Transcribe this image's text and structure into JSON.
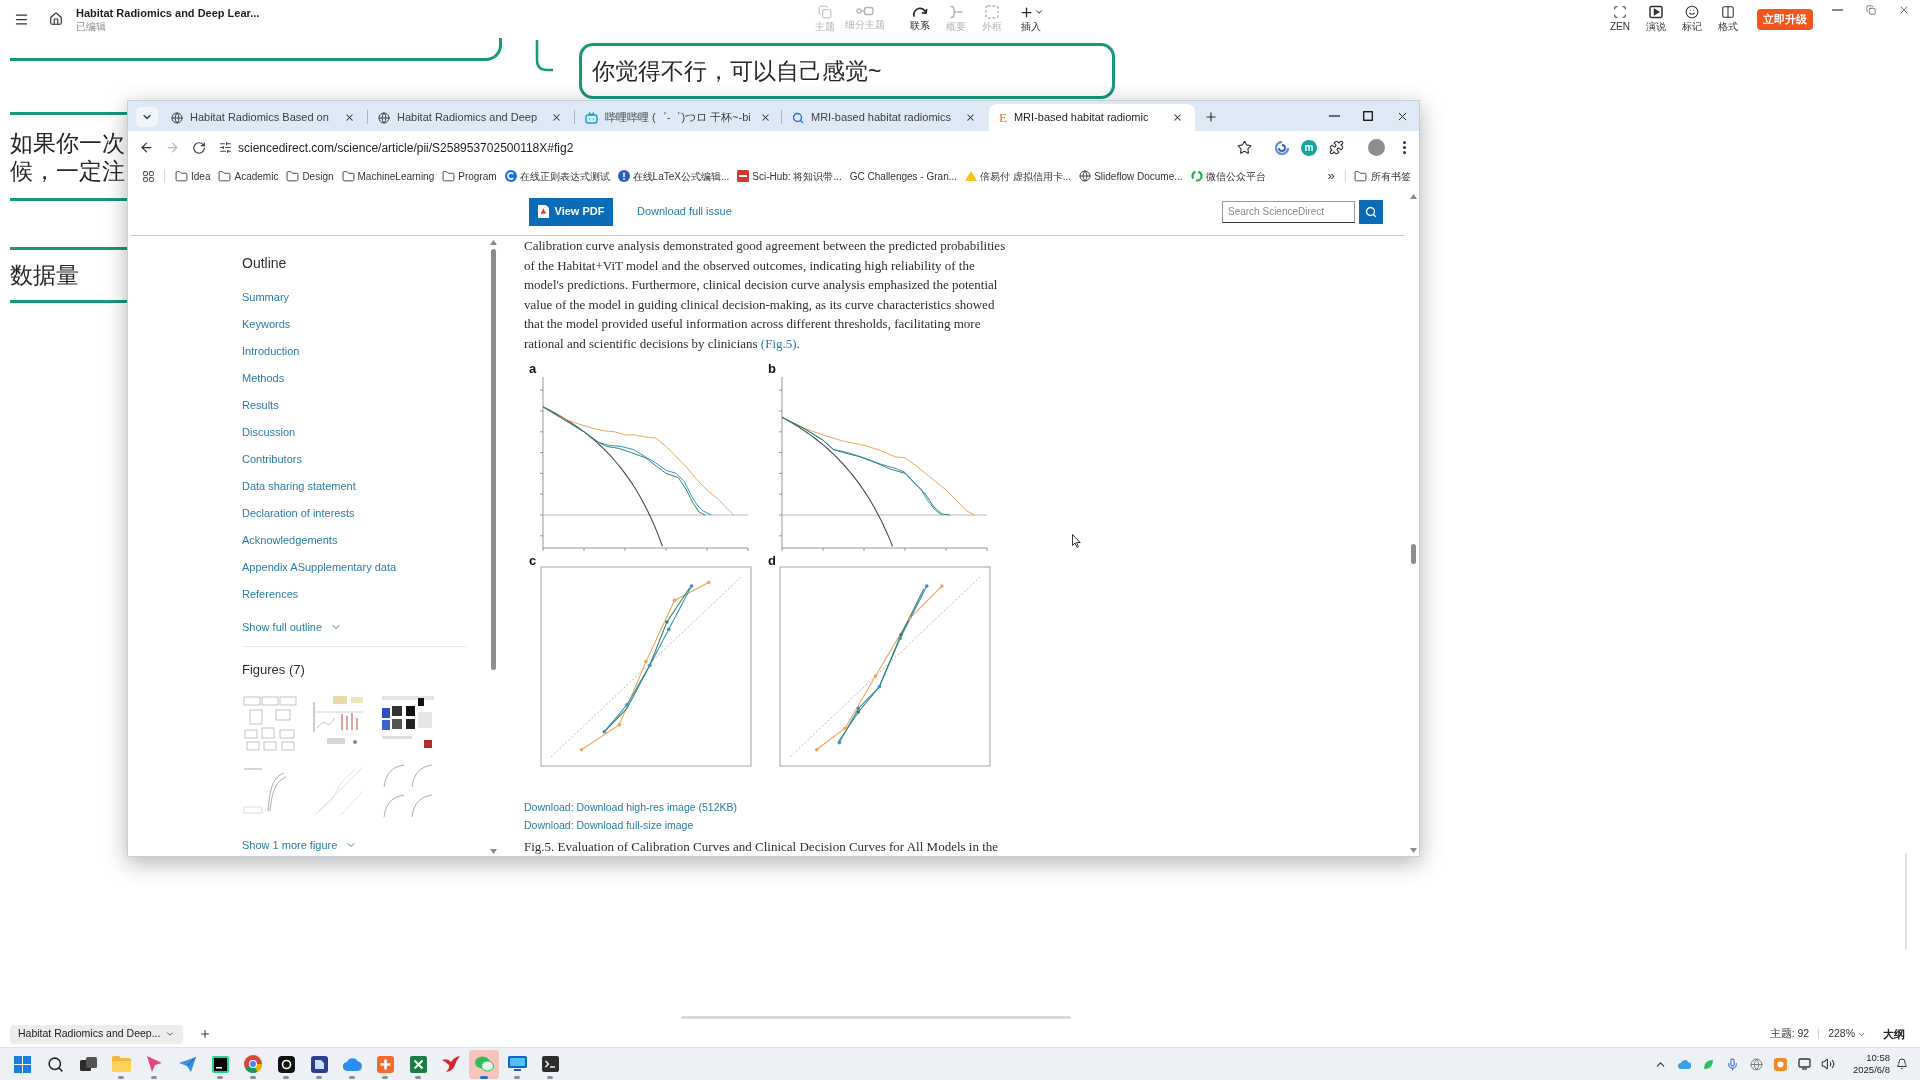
{
  "app": {
    "title": "Habitat Radiomics and Deep Lear...",
    "status": "已编辑",
    "toolbar": [
      {
        "label": "主题",
        "kind": "topic",
        "disabled": true
      },
      {
        "label": "细分主题",
        "kind": "subtopic",
        "disabled": true
      },
      {
        "label": "联系",
        "kind": "relation",
        "disabled": false
      },
      {
        "label": "概要",
        "kind": "summary",
        "disabled": true
      },
      {
        "label": "外框",
        "kind": "boundary",
        "disabled": true
      },
      {
        "label": "插入",
        "kind": "insert",
        "disabled": false
      }
    ],
    "view_tools": [
      {
        "label": "ZEN",
        "kind": "zen"
      },
      {
        "label": "演说",
        "kind": "pitch"
      },
      {
        "label": "标记",
        "kind": "marker"
      },
      {
        "label": "格式",
        "kind": "format"
      }
    ],
    "upgrade": "立即升级"
  },
  "mind_map": {
    "nodes": [
      {
        "kind": "clipped"
      },
      {
        "kind": "connector"
      },
      {
        "kind": "callout",
        "lines": [
          "你觉得不行，可以自己感觉~"
        ]
      },
      {
        "kind": "band",
        "lines": [
          "如果你一次",
          "候，一定注"
        ]
      },
      {
        "kind": "band",
        "lines": [
          "数据量"
        ]
      }
    ]
  },
  "browser": {
    "tabs": [
      {
        "title": "Habitat Radiomics Based on",
        "kind": "globe",
        "selected": false
      },
      {
        "title": "Habitat Radiomics and Deep",
        "kind": "globe",
        "selected": false
      },
      {
        "title": "哔哩哔哩 (゜-゜)つロ 干杯~-bi",
        "kind": "tv",
        "selected": false
      },
      {
        "title": "MRI-based habitat radiomics",
        "kind": "search",
        "selected": false
      },
      {
        "title": "MRI-based habitat radiomic",
        "kind": "letter",
        "glyph": "E",
        "selected": true
      }
    ],
    "nav": {
      "back_disabled": false,
      "forward_disabled": true
    },
    "address": "sciencedirect.com/science/article/pii/S258953702500118X#fig2",
    "extension": "m",
    "bookmarks": [
      {
        "label": "Idea",
        "kind": "folder"
      },
      {
        "label": "Academic",
        "kind": "folder"
      },
      {
        "label": "Design",
        "kind": "folder"
      },
      {
        "label": "MachineLearning",
        "kind": "folder"
      },
      {
        "label": "Program",
        "kind": "folder"
      },
      {
        "label": "在线正则表达式测试",
        "kind": "ring"
      },
      {
        "label": "在线LaTeX公式编辑...",
        "kind": "dot"
      },
      {
        "label": "Sci-Hub: 将知识带...",
        "kind": "tile"
      },
      {
        "label": "GC Challenges - Gran...",
        "kind": "none"
      },
      {
        "label": "倍易付 虚拟信用卡...",
        "kind": "wedge"
      },
      {
        "label": "Slideflow Docume...",
        "kind": "globe"
      },
      {
        "label": "微信公众平台",
        "kind": "swirl"
      }
    ],
    "overflow": "»",
    "all_bookmarks": "所有书签"
  },
  "page": {
    "view_pdf": "View PDF",
    "download_issue": "Download full issue",
    "search_placeholder": "Search ScienceDirect",
    "outline": {
      "title": "Outline",
      "items": [
        "Summary",
        "Keywords",
        "Introduction",
        "Methods",
        "Results",
        "Discussion",
        "Contributors",
        "Data sharing statement",
        "Declaration of interests",
        "Acknowledgements",
        "Appendix ASupplementary data",
        "References"
      ],
      "more": "Show full outline"
    },
    "figures": {
      "title": "Figures (7)",
      "thumbnails": [
        {
          "kind": "flowchart"
        },
        {
          "kind": "plots"
        },
        {
          "kind": "scans"
        },
        {
          "kind": "roc"
        },
        {
          "kind": "calibration"
        },
        {
          "kind": "roc_grid"
        }
      ],
      "more": "Show 1 more figure"
    },
    "article": {
      "text": "Calibration curve analysis demonstrated good agreement between the predicted probabilities of the Habitat+ViT model and the observed outcomes, indicating high reliability of the model's predictions. Furthermore, clinical decision curve analysis emphasized the potential value of the model in guiding clinical decision-making, as its curve characteristics showed that the model provided useful information across different thresholds, facilitating more rational and scientific decisions by clinicians",
      "link": "(Fig.5)",
      "tail": ".",
      "figure": {
        "panels": [
          {
            "label": "a",
            "kind": "dca"
          },
          {
            "label": "b",
            "kind": "dca"
          },
          {
            "label": "c",
            "kind": "calibration"
          },
          {
            "label": "d",
            "kind": "calibration"
          }
        ]
      },
      "downloads": [
        "Download: Download high-res image (512KB)",
        "Download: Download full-size image"
      ],
      "caption": "Fig.5. Evaluation of Calibration Curves and Clinical Decision Curves for All Models in the"
    }
  },
  "status_bar": {
    "sheet": "Habitat Radiomics and Deep...",
    "topics": "主题: 92",
    "zoom": "228%",
    "outline": "大纲"
  },
  "taskbar": {
    "apps": [
      {
        "kind": "start",
        "running": false,
        "selected": false
      },
      {
        "kind": "search",
        "running": false,
        "selected": false
      },
      {
        "kind": "taskview",
        "running": false,
        "selected": false
      },
      {
        "kind": "folder",
        "running": true,
        "selected": false
      },
      {
        "kind": "pointer",
        "running": true,
        "selected": false
      },
      {
        "kind": "plane",
        "running": false,
        "selected": false
      },
      {
        "kind": "editor",
        "running": true,
        "selected": false
      },
      {
        "kind": "browser",
        "running": true,
        "selected": false
      },
      {
        "kind": "recorder",
        "running": true,
        "selected": false
      },
      {
        "kind": "document",
        "running": true,
        "selected": false
      },
      {
        "kind": "cloud",
        "running": true,
        "selected": false
      },
      {
        "kind": "tile",
        "running": true,
        "selected": false
      },
      {
        "kind": "sheet",
        "running": true,
        "selected": false
      },
      {
        "kind": "bird",
        "running": false,
        "selected": false
      },
      {
        "kind": "chat",
        "running": true,
        "selected": true
      },
      {
        "kind": "monitor",
        "running": true,
        "selected": false
      },
      {
        "kind": "terminal",
        "running": true,
        "selected": false
      }
    ],
    "time": "10:58",
    "date": "2025/6/8"
  }
}
